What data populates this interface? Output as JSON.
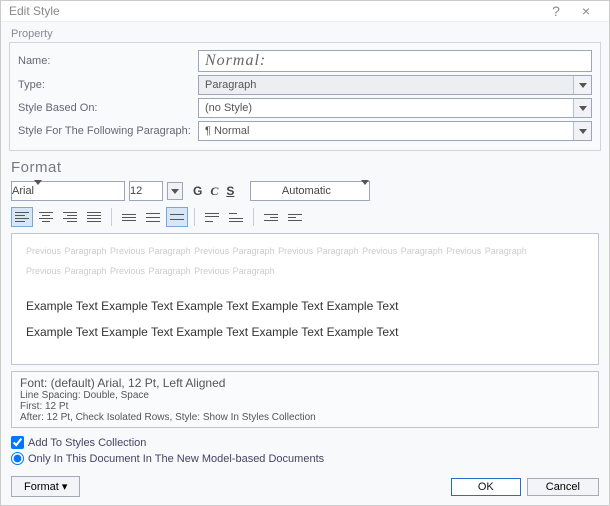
{
  "titlebar": {
    "title": "Edit Style",
    "help": "?",
    "close": "×"
  },
  "property": {
    "legend": "Property",
    "name_label": "Name:",
    "name_value": "Normal:",
    "type_label": "Type:",
    "type_value": "Paragraph",
    "based_label": "Style Based On:",
    "based_value": "(no Style)",
    "follow_label": "Style For The Following Paragraph:",
    "follow_value": "¶ Normal"
  },
  "format": {
    "legend": "Format",
    "font": "Arial",
    "size": "12",
    "bold": "G",
    "italic": "C",
    "underline": "S",
    "color": "Automatic"
  },
  "preview": {
    "prev_text": "Previous Paragraph Previous Paragraph Previous Paragraph Previous Paragraph Previous Paragraph Previous Paragraph",
    "prev_text2": "Previous Paragraph Previous Paragraph Previous Paragraph",
    "sample": "Example Text Example Text Example Text Example Text Example Text",
    "sample2": "Example Text Example Text Example Text Example Text Example Text"
  },
  "summary": {
    "line1": "Font: (default) Arial, 12 Pt, Left Aligned",
    "line2": "Line Spacing: Double, Space",
    "line3": "First: 12 Pt",
    "line4": "After: 12 Pt, Check Isolated Rows, Style: Show In Styles Collection"
  },
  "options": {
    "add": "Add To Styles Collection",
    "scope": "Only In This Document In The New Model-based Documents"
  },
  "buttons": {
    "format": "Format ▾",
    "ok": "OK",
    "cancel": "Cancel"
  }
}
